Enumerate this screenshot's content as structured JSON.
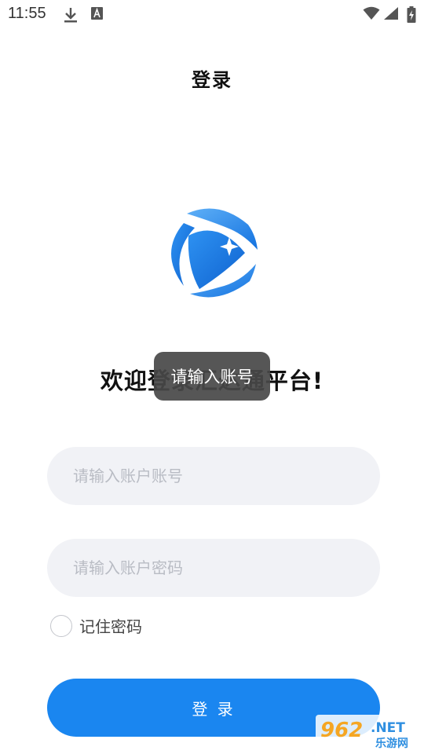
{
  "status_bar": {
    "time": "11:55",
    "icons": [
      "download-icon",
      "a-icon",
      "wifi-icon",
      "signal-icon",
      "battery-icon"
    ]
  },
  "header": {
    "title": "登录"
  },
  "logo": {
    "icon": "app-logo-icon",
    "colors": {
      "primary": "#1a86f0",
      "light": "#5fb0f7"
    }
  },
  "welcome": {
    "text": "欢迎登录汇达通平台!"
  },
  "toast": {
    "text": "请输入账号"
  },
  "form": {
    "account_placeholder": "请输入账户账号",
    "account_value": "",
    "password_placeholder": "请输入账户密码",
    "password_value": "",
    "remember_label": "记住密码",
    "remember_checked": false,
    "submit_label": "登 录"
  },
  "watermark": {
    "number": "962",
    "suffix": ".NET",
    "subtext": "乐游网"
  },
  "colors": {
    "accent": "#1a86f0",
    "field_bg": "#f1f2f6",
    "placeholder": "#b9bcc4"
  }
}
